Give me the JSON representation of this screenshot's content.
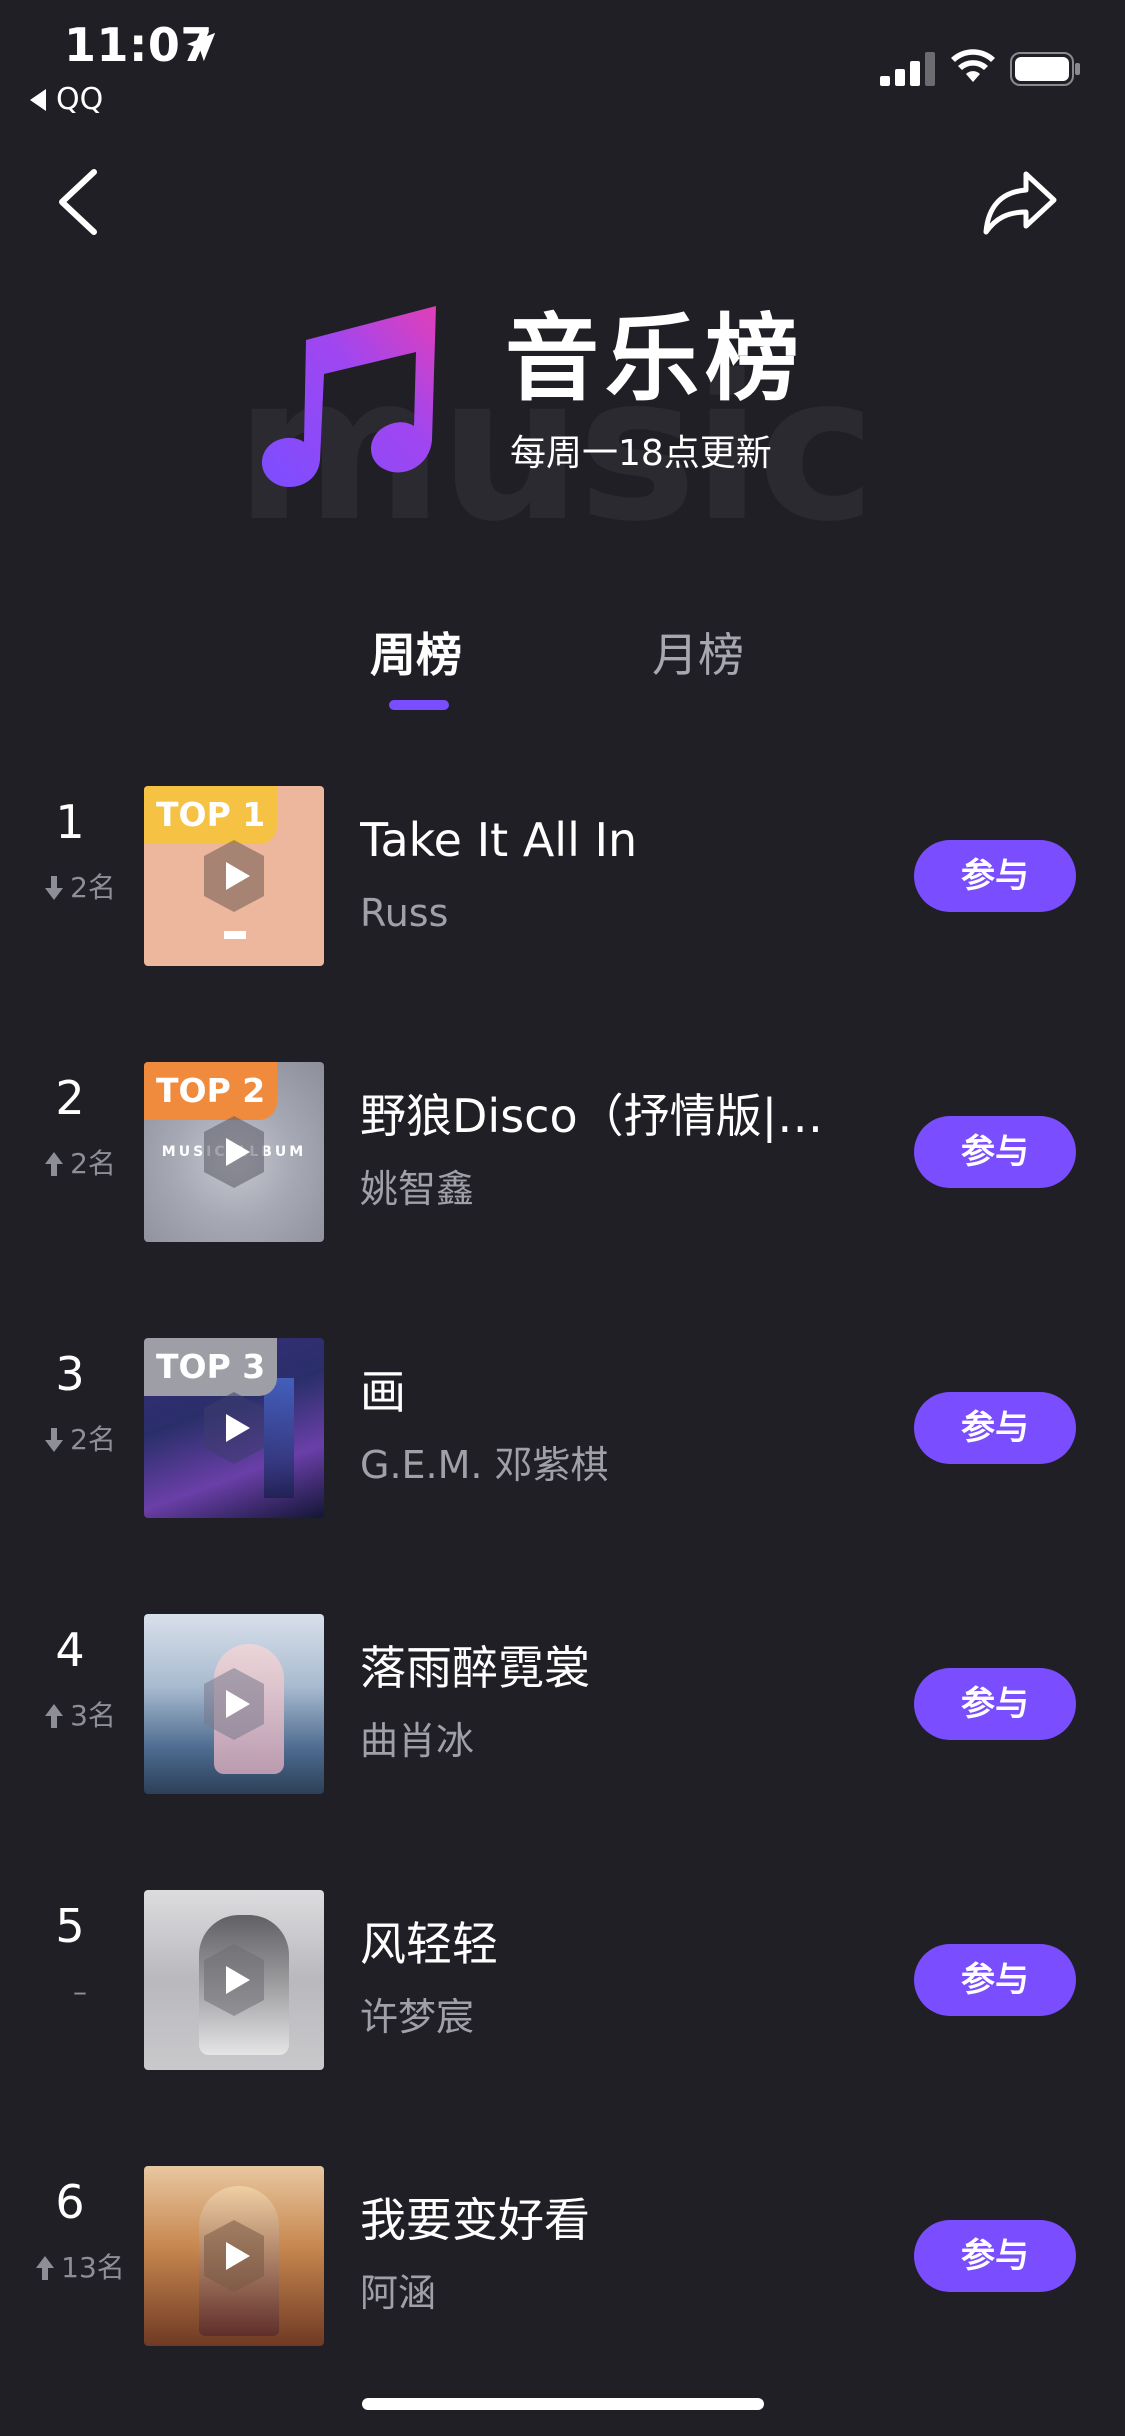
{
  "status_bar": {
    "time": "11:07",
    "back_app": "QQ"
  },
  "header": {
    "background_word": "music",
    "title": "音乐榜",
    "subtitle": "每周一18点更新"
  },
  "tabs": [
    {
      "label": "周榜",
      "active": true
    },
    {
      "label": "月榜",
      "active": false
    }
  ],
  "colors": {
    "background": "#1f1f25",
    "accent": "#7a4dff",
    "top1_badge": "#f5c244",
    "top2_badge": "#f08a3c",
    "top3_badge": "#9e9ea6"
  },
  "chart_list": [
    {
      "rank": "1",
      "trend": "down",
      "change": "2名",
      "badge": "TOP 1",
      "title": "Take It All In",
      "artist": "Russ",
      "button": "参与",
      "cover_color": "#ecb79c"
    },
    {
      "rank": "2",
      "trend": "up",
      "change": "2名",
      "badge": "TOP 2",
      "title": "野狼Disco（抒情版|…",
      "artist": "姚智鑫",
      "button": "参与",
      "cover_color": "#a6a8b4"
    },
    {
      "rank": "3",
      "trend": "down",
      "change": "2名",
      "badge": "TOP 3",
      "title": "画",
      "artist": "G.E.M. 邓紫棋",
      "button": "参与",
      "cover_color": "#2a2f6a"
    },
    {
      "rank": "4",
      "trend": "up",
      "change": "3名",
      "badge": "",
      "title": "落雨醉霓裳",
      "artist": "曲肖冰",
      "button": "参与",
      "cover_color": "#6d87a8"
    },
    {
      "rank": "5",
      "trend": "none",
      "change": "–",
      "badge": "",
      "title": "风轻轻",
      "artist": "许梦宸",
      "button": "参与",
      "cover_color": "#b9b9bd"
    },
    {
      "rank": "6",
      "trend": "up",
      "change": "13名",
      "badge": "",
      "title": "我要变好看",
      "artist": "阿涵",
      "button": "参与",
      "cover_color": "#c7874f"
    }
  ]
}
